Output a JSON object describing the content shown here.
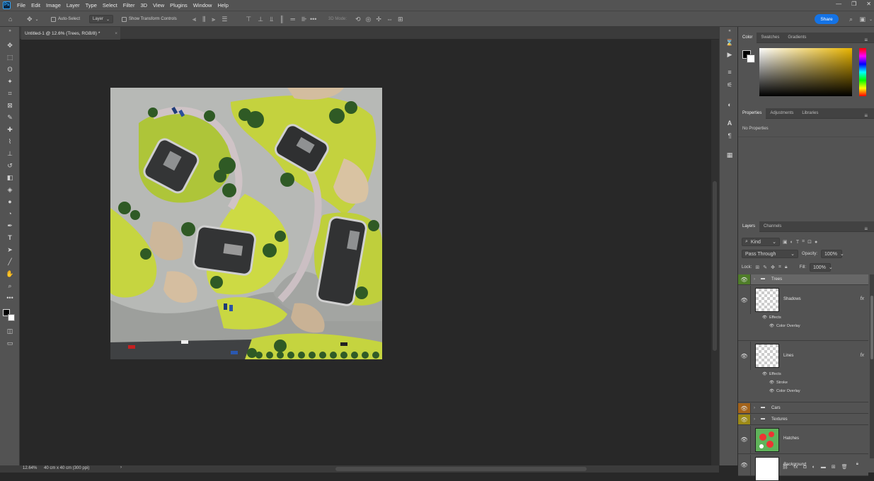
{
  "menubar": {
    "app_logo": "Ps",
    "items": [
      "File",
      "Edit",
      "Image",
      "Layer",
      "Type",
      "Select",
      "Filter",
      "3D",
      "View",
      "Plugins",
      "Window",
      "Help"
    ],
    "window_controls": [
      "—",
      "❐",
      "✕"
    ]
  },
  "options": {
    "auto_select_label": "Auto-Select",
    "auto_select_target": "Layer",
    "show_transform_label": "Show Transform Controls",
    "mode_3d_label": "3D Mode:",
    "share_label": "Share"
  },
  "document": {
    "tab_title": "Untitled-1 @ 12.6% (Trees, RGB/8) *",
    "tab_close": "×"
  },
  "status": {
    "zoom": "12.64%",
    "doc_info": "40 cm x 40 cm (300 ppi)",
    "arrow": "›"
  },
  "color_panel": {
    "tabs": [
      "Color",
      "Swatches",
      "Gradients"
    ],
    "accent": "#e8b400"
  },
  "properties_panel": {
    "tabs": [
      "Properties",
      "Adjustments",
      "Libraries"
    ],
    "empty_label": "No Properties"
  },
  "layers_panel": {
    "tabs": [
      "Layers",
      "Channels"
    ],
    "filter_kind": "Kind",
    "blend_mode": "Pass Through",
    "opacity_label": "Opacity:",
    "opacity_value": "100%",
    "lock_label": "Lock:",
    "fill_label": "Fill:",
    "fill_value": "100%",
    "layers": [
      {
        "name": "Trees",
        "type": "group",
        "eye_color": "#4f7d29",
        "selected": true
      },
      {
        "name": "Shadows",
        "type": "layer",
        "fx": "fx",
        "effects_label": "Effects",
        "effects": [
          "Color Overlay"
        ]
      },
      {
        "name": "Lines",
        "type": "layer",
        "fx": "fx",
        "effects_label": "Effects",
        "effects": [
          "Stroke",
          "Color Overlay"
        ]
      },
      {
        "name": "Cars",
        "type": "group",
        "eye_color": "#a4631a"
      },
      {
        "name": "Textures",
        "type": "group",
        "eye_color": "#9d8a17"
      },
      {
        "name": "Hatches",
        "type": "layer"
      },
      {
        "name": "Background",
        "type": "background"
      }
    ]
  }
}
